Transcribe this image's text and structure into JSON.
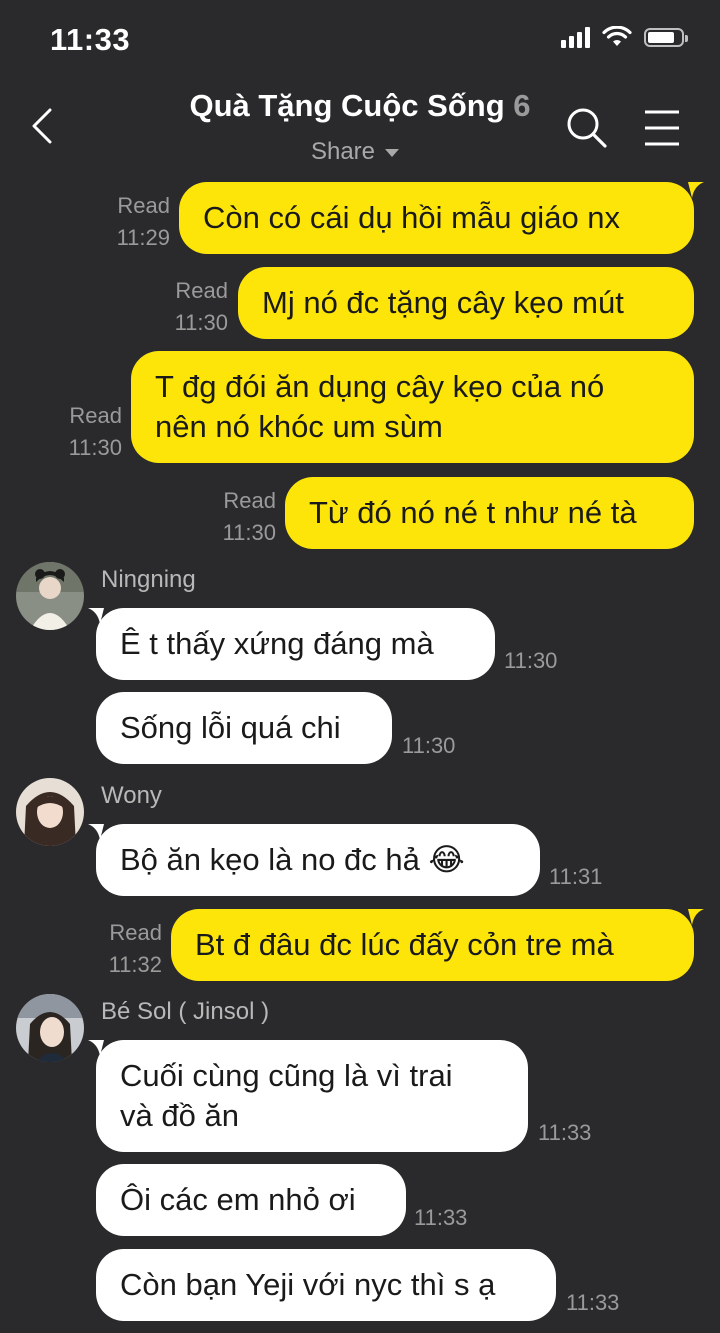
{
  "status": {
    "time": "11:33"
  },
  "header": {
    "title": "Quà Tặng Cuộc Sống",
    "member_count": "6",
    "share_label": "Share"
  },
  "messages": [
    {
      "read": "Read",
      "time": "11:29",
      "text": "Còn có cái dụ hồi mẫu giáo nx"
    },
    {
      "read": "Read",
      "time": "11:30",
      "text": "Mj nó đc tặng cây kẹo mút"
    },
    {
      "read": "Read",
      "time": "11:30",
      "line1": "T đg đói ăn dụng cây kẹo của nó",
      "line2": "nên nó khóc um sùm"
    },
    {
      "read": "Read",
      "time": "11:30",
      "text": "Từ đó nó né t như né tà"
    },
    {
      "sender": "Ningning",
      "text": "Ê t thấy xứng đáng mà",
      "time": "11:30"
    },
    {
      "text": "Sống lỗi quá chi",
      "time": "11:30"
    },
    {
      "sender": "Wony",
      "text": "Bộ ăn kẹo là no đc hả",
      "emoji": "😂",
      "time": "11:31"
    },
    {
      "read": "Read",
      "time": "11:32",
      "text": "Bt đ đâu đc lúc đấy cỏn tre mà"
    },
    {
      "sender": "Bé Sol ( Jinsol )",
      "line1": "Cuối cùng cũng là vì trai",
      "line2": "và đồ ăn",
      "time": "11:33"
    },
    {
      "text": "Ôi các em nhỏ ơi",
      "time": "11:33"
    },
    {
      "text": "Còn bạn Yeji với nyc thì s ạ",
      "time": "11:33"
    }
  ],
  "colors": {
    "background": "#2a2a2c",
    "outgoing_bubble": "#fde50a",
    "incoming_bubble": "#ffffff",
    "meta_text": "#9a9a9a"
  },
  "icons": [
    "back-chevron-icon",
    "search-icon",
    "menu-icon",
    "signal-icon",
    "wifi-icon",
    "battery-icon",
    "share-caret-icon"
  ]
}
